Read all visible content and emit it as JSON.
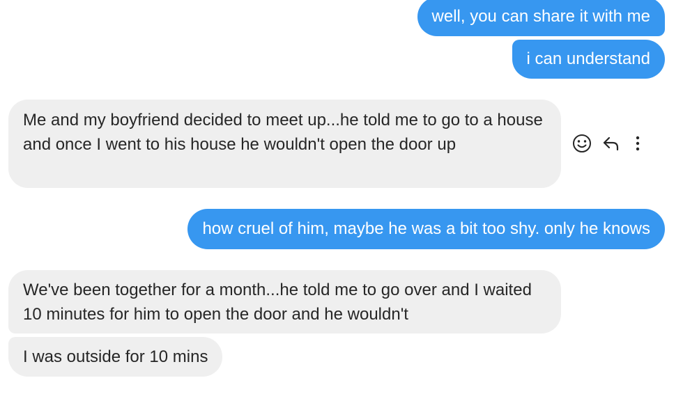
{
  "conversation": {
    "messages": [
      {
        "sender": "me",
        "text": "well, you can share it with me"
      },
      {
        "sender": "me",
        "text": "i can understand"
      },
      {
        "sender": "them",
        "text": "Me and my boyfriend decided to meet up...he told me to go to a house and once I went to his house he wouldn't open the door up"
      },
      {
        "sender": "me",
        "text": "how cruel of him, maybe he was a bit too shy. only he knows"
      },
      {
        "sender": "them",
        "text": "We've been together for a month...he told me to go over and I waited 10 minutes for him to open the door and he wouldn't"
      },
      {
        "sender": "them",
        "text": "I was outside for 10 mins"
      }
    ]
  },
  "message_actions": {
    "icons": [
      "emoji-reaction-icon",
      "reply-icon",
      "more-options-icon"
    ]
  },
  "colors": {
    "outgoing_bubble": "#3797f0",
    "incoming_bubble": "#efefef",
    "incoming_text": "#262626",
    "icon_color": "#262626"
  }
}
